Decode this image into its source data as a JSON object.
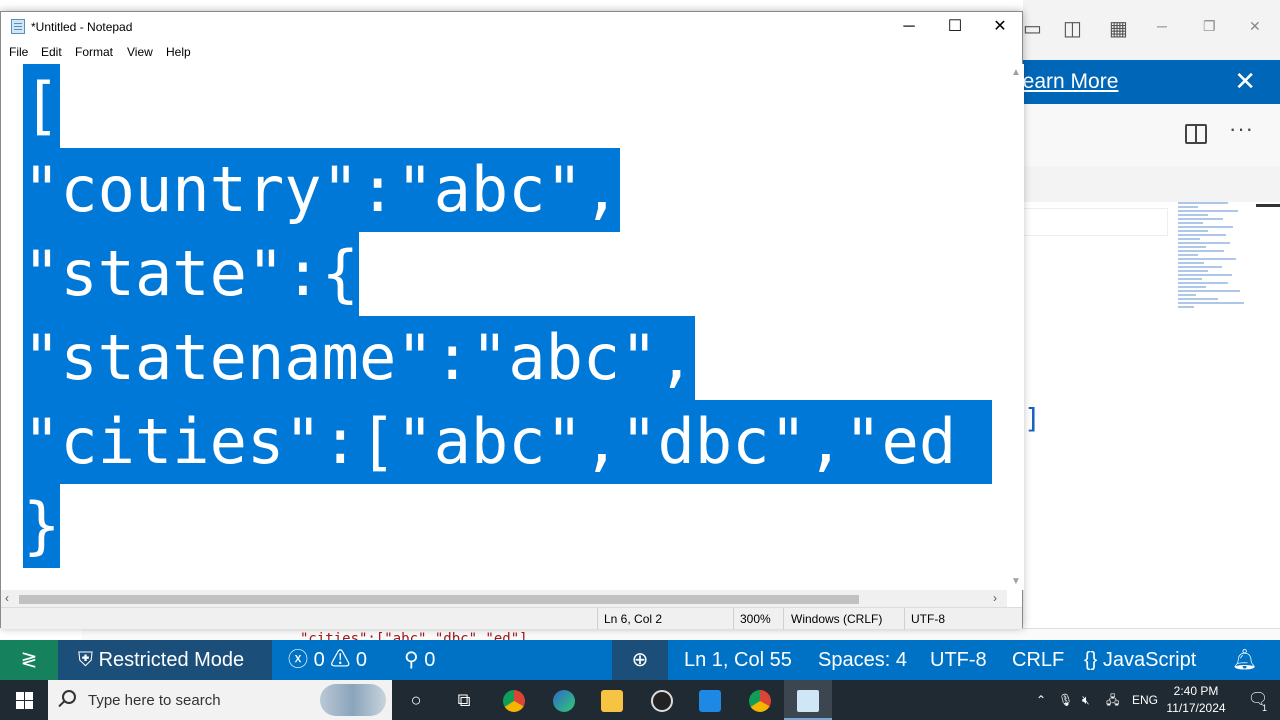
{
  "notepad": {
    "title": "*Untitled - Notepad",
    "menu": [
      "File",
      "Edit",
      "Format",
      "View",
      "Help"
    ],
    "content_lines": [
      "[",
      "\"country\":\"abc\",",
      "\"state\":{",
      "\"statename\":\"abc\",",
      "\"cities\":[\"abc\",\"dbc\",\"ed",
      "}"
    ],
    "status": {
      "position": "Ln 6, Col 2",
      "zoom": "300%",
      "line_ending": "Windows (CRLF)",
      "encoding": "UTF-8"
    },
    "colors": {
      "selection": "#0078d7"
    }
  },
  "vscode": {
    "banner_link": "Learn More",
    "bottom_code_fragment": "\"cities\":[\"abc\",\"dbc\",\"ed\"]",
    "statusbar": {
      "remote_icon": "remote-icon",
      "restricted_mode": "Restricted Mode",
      "errors": "0",
      "warnings": "0",
      "ports": "0",
      "position": "Ln 1, Col 55",
      "spaces": "Spaces: 4",
      "encoding": "UTF-8",
      "line_ending": "CRLF",
      "language": "JavaScript"
    },
    "colors": {
      "statusbar": "#0072c6",
      "banner": "#0066b8"
    }
  },
  "taskbar": {
    "search_placeholder": "Type here to search",
    "apps": [
      "cortana-icon",
      "task-view-icon",
      "chrome-icon",
      "edge-icon",
      "file-explorer-icon",
      "obs-icon",
      "vscode-icon",
      "chrome-profile-icon",
      "notepad-icon"
    ],
    "language": "ENG",
    "time": "2:40 PM",
    "date": "11/17/2024",
    "notification_count": "1"
  }
}
